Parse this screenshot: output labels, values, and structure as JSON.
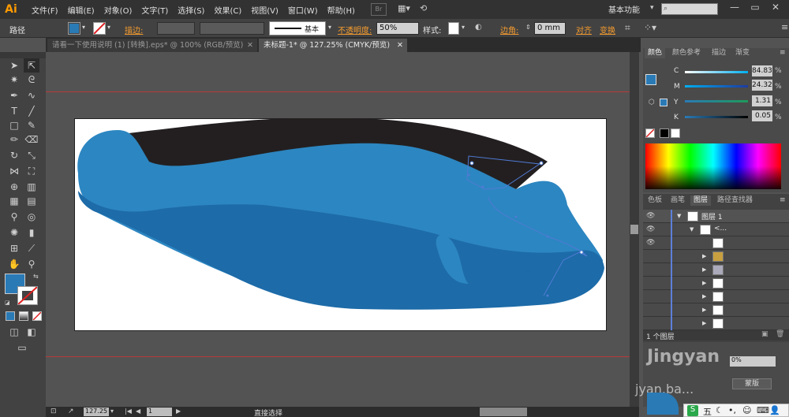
{
  "menubar": {
    "logo": "Ai",
    "items": [
      "文件(F)",
      "编辑(E)",
      "对象(O)",
      "文字(T)",
      "选择(S)",
      "效果(C)",
      "视图(V)",
      "窗口(W)",
      "帮助(H)"
    ],
    "br_label": "Br",
    "workspace": "基本功能"
  },
  "controlbar": {
    "path_label": "路径",
    "stroke_label": "描边:",
    "stroke_style": "基本",
    "opacity_label": "不透明度:",
    "opacity_value": "50%",
    "style_label": "样式:",
    "corner_label": "边角:",
    "corner_value": "0 mm",
    "align_label": "对齐",
    "transform_label": "变换",
    "fill_color": "#2a7ab5"
  },
  "tabs": [
    {
      "label": "请看一下使用说明 (1) [转换].eps* @ 100% (RGB/预览)",
      "active": false
    },
    {
      "label": "未标题-1* @ 127.25% (CMYK/预览)",
      "active": true
    }
  ],
  "statusbar": {
    "zoom": "127.25",
    "page": "1",
    "tool_name": "直接选择"
  },
  "color_panel": {
    "tabs": [
      "颜色",
      "颜色参考",
      "描边",
      "渐变"
    ],
    "channels": [
      {
        "name": "C",
        "value": "84.83"
      },
      {
        "name": "M",
        "value": "24.32"
      },
      {
        "name": "Y",
        "value": "1.31"
      },
      {
        "name": "K",
        "value": "0.05"
      }
    ],
    "percent_sign": "%"
  },
  "layers_panel": {
    "tabs": [
      "色板",
      "画笔",
      "图层",
      "路径查找器"
    ],
    "layer_name": "图层 1",
    "sublayer_name": "<...",
    "footer": "1 个图层"
  },
  "watermark": {
    "text1": "Jingyan",
    "text2": "jyan.ba...",
    "button": "蒙版"
  },
  "ime": {
    "label": "五"
  }
}
